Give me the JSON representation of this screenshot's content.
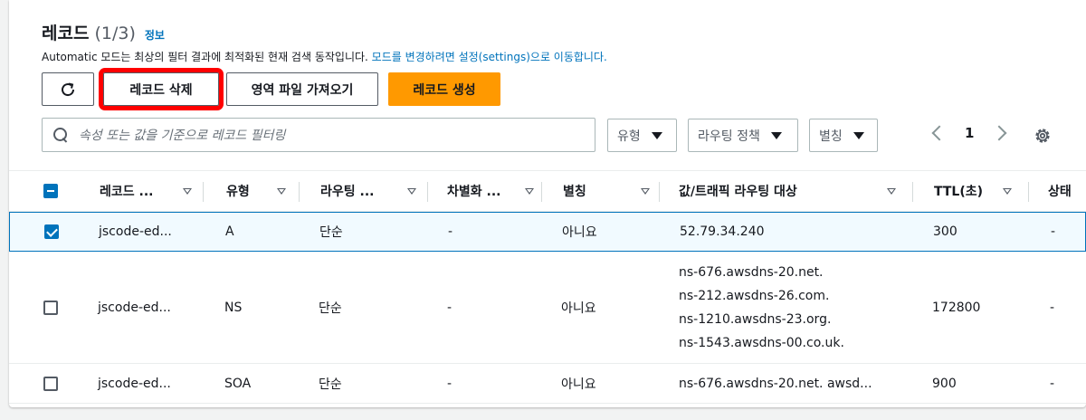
{
  "header": {
    "title": "레코드",
    "count": "(1/3)",
    "info": "정보",
    "desc_prefix": "Automatic 모드는 최상의 필터 결과에 최적화된 현재 검색 동작입니다. ",
    "desc_link": "모드를 변경하려면 설정(settings)으로 이동합니다."
  },
  "toolbar": {
    "delete_label": "레코드 삭제",
    "import_label": "영역 파일 가져오기",
    "create_label": "레코드 생성"
  },
  "filter": {
    "placeholder": "속성 또는 값을 기준으로 레코드 필터링",
    "type_label": "유형",
    "routing_label": "라우팅 정책",
    "alias_label": "별칭"
  },
  "pagination": {
    "current_page": "1"
  },
  "columns": [
    "레코드 ...",
    "유형",
    "라우팅 ...",
    "차별화 ...",
    "별칭",
    "값/트래픽 라우팅 대상",
    "TTL(초)",
    "상태"
  ],
  "rows": [
    {
      "selected": true,
      "name": "jscode-ed...",
      "type": "A",
      "routing": "단순",
      "diff": "-",
      "alias": "아니요",
      "value": [
        "52.79.34.240"
      ],
      "ttl": "300",
      "status": "-"
    },
    {
      "selected": false,
      "name": "jscode-ed...",
      "type": "NS",
      "routing": "단순",
      "diff": "-",
      "alias": "아니요",
      "value": [
        "ns-676.awsdns-20.net.",
        "ns-212.awsdns-26.com.",
        "ns-1210.awsdns-23.org.",
        "ns-1543.awsdns-00.co.uk."
      ],
      "ttl": "172800",
      "status": "-"
    },
    {
      "selected": false,
      "name": "jscode-ed...",
      "type": "SOA",
      "routing": "단순",
      "diff": "-",
      "alias": "아니요",
      "value": [
        "ns-676.awsdns-20.net. awsd..."
      ],
      "ttl": "900",
      "status": "-"
    }
  ],
  "colors": {
    "accent": "#0073bb",
    "primary_button": "#ff9900",
    "highlight_box": "#ff0000"
  }
}
